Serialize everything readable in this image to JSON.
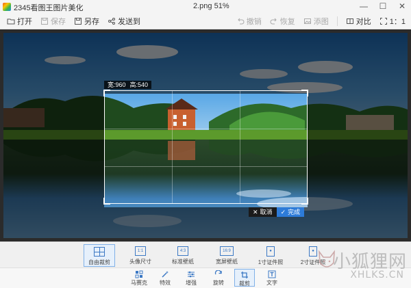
{
  "titlebar": {
    "app_title": "2345看图王图片美化",
    "file_title": "2.png   51%"
  },
  "toolbar": {
    "left": [
      {
        "label": "打开",
        "icon": "folder-icon",
        "disabled": false
      },
      {
        "label": "保存",
        "icon": "save-icon",
        "disabled": true
      },
      {
        "label": "另存",
        "icon": "save-as-icon",
        "disabled": false
      },
      {
        "label": "发送到",
        "icon": "share-icon",
        "disabled": false
      }
    ],
    "right": [
      {
        "label": "撤销",
        "icon": "undo-icon",
        "disabled": true
      },
      {
        "label": "恢复",
        "icon": "redo-icon",
        "disabled": true
      },
      {
        "label": "添图",
        "icon": "add-image-icon",
        "disabled": true
      },
      {
        "label": "对比",
        "icon": "compare-icon",
        "disabled": false
      },
      {
        "label": "1：1",
        "icon": "actual-size-icon",
        "disabled": false
      }
    ]
  },
  "crop": {
    "size_width": "宽:960",
    "size_height": "高:540",
    "cancel_label": "取消",
    "ok_label": "完成"
  },
  "sub_tools": [
    {
      "label": "自由裁剪",
      "icon_text": "",
      "active": true
    },
    {
      "label": "头像尺寸",
      "icon_text": "1:1",
      "active": false
    },
    {
      "label": "标准壁纸",
      "icon_text": "4:3",
      "active": false
    },
    {
      "label": "宽屏壁纸",
      "icon_text": "16:9",
      "active": false
    },
    {
      "label": "1寸证件照",
      "icon_text": "",
      "active": false
    },
    {
      "label": "2寸证件照",
      "icon_text": "",
      "active": false
    }
  ],
  "main_tools": [
    {
      "label": "马赛克",
      "icon": "mosaic-icon",
      "active": false
    },
    {
      "label": "特效",
      "icon": "effects-wand-icon",
      "active": false
    },
    {
      "label": "增强",
      "icon": "enhance-sliders-icon",
      "active": false
    },
    {
      "label": "旋转",
      "icon": "rotate-icon",
      "active": false
    },
    {
      "label": "裁剪",
      "icon": "crop-icon",
      "active": true
    },
    {
      "label": "文字",
      "icon": "text-icon",
      "active": false
    }
  ],
  "watermark": {
    "line1": "小狐狸网",
    "line2": "XHLKS.CN"
  },
  "colors": {
    "accent": "#2d7bd8",
    "active_border": "#7fb0e8"
  }
}
